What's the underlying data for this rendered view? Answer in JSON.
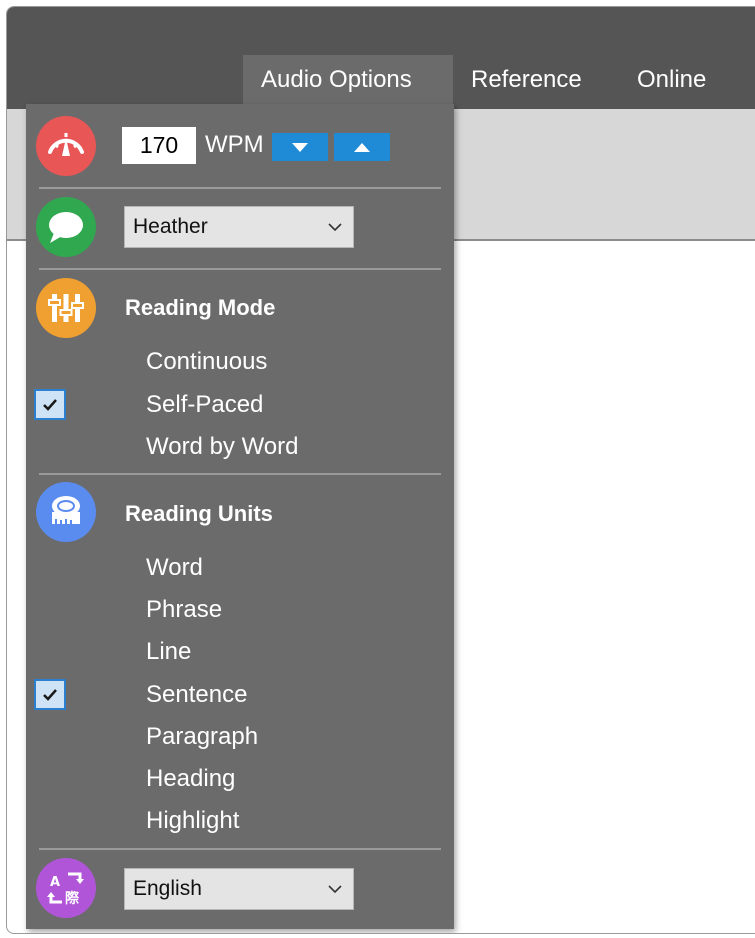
{
  "tabs": [
    {
      "label": "Audio Options",
      "active": true
    },
    {
      "label": "Reference",
      "active": false
    },
    {
      "label": "Online",
      "active": false
    }
  ],
  "speed": {
    "value": "170",
    "unit": "WPM",
    "decrease_icon": "triangle-down-icon",
    "increase_icon": "triangle-up-icon"
  },
  "voice": {
    "selected": "Heather",
    "icon": "speech-bubble-icon"
  },
  "reading_mode": {
    "heading": "Reading Mode",
    "icon": "equalizer-sliders-icon",
    "options": [
      {
        "label": "Continuous",
        "checked": false
      },
      {
        "label": "Self-Paced",
        "checked": true
      },
      {
        "label": "Word by Word",
        "checked": false
      }
    ]
  },
  "reading_units": {
    "heading": "Reading Units",
    "icon": "tape-measure-icon",
    "options": [
      {
        "label": "Word",
        "checked": false
      },
      {
        "label": "Phrase",
        "checked": false
      },
      {
        "label": "Line",
        "checked": false
      },
      {
        "label": "Sentence",
        "checked": true
      },
      {
        "label": "Paragraph",
        "checked": false
      },
      {
        "label": "Heading",
        "checked": false
      },
      {
        "label": "Highlight",
        "checked": false
      }
    ]
  },
  "language": {
    "selected": "English",
    "icon": "translate-icon"
  },
  "colors": {
    "speed_icon": "#e95656",
    "voice_icon": "#2fa84f",
    "mode_icon": "#f0a030",
    "units_icon": "#5a8cf0",
    "language_icon": "#b055d8",
    "accent": "#1f8ad6"
  }
}
